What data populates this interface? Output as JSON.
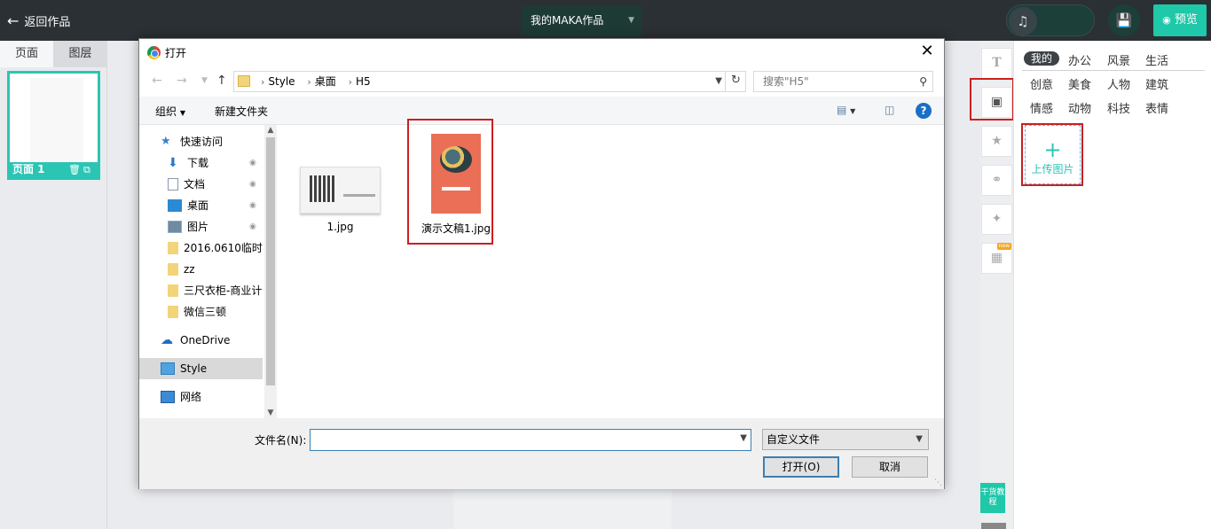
{
  "topbar": {
    "back_label": "返回作品",
    "work_title": "我的MAKA作品",
    "preview_label": "预览"
  },
  "left_panel": {
    "tabs": [
      "页面",
      "图层"
    ],
    "page_label": "页面 1"
  },
  "right_panel": {
    "categories": [
      "我的",
      "办公",
      "风景",
      "生活",
      "创意",
      "美食",
      "人物",
      "建筑",
      "情感",
      "动物",
      "科技",
      "表情"
    ],
    "upload_label": "上传图片",
    "tutorial_label": "干货教程",
    "new_badge": "new"
  },
  "dialog": {
    "title": "打开",
    "breadcrumb": [
      "Style",
      "桌面",
      "H5"
    ],
    "search_placeholder": "搜索\"H5\"",
    "toolbar": {
      "organize": "组织",
      "new_folder": "新建文件夹",
      "help": "?"
    },
    "nav_items": [
      "快速访问",
      "下载",
      "文档",
      "桌面",
      "图片",
      "2016.0610临时",
      "zz",
      "三尺衣柜-商业计",
      "微信三顿",
      "OneDrive",
      "Style",
      "网络"
    ],
    "files": [
      {
        "name": "1.jpg"
      },
      {
        "name": "演示文稿1.jpg"
      }
    ],
    "filename_label": "文件名(N):",
    "filename_value": "",
    "filetype": "自定义文件",
    "open_button": "打开(O)",
    "cancel_button": "取消"
  }
}
